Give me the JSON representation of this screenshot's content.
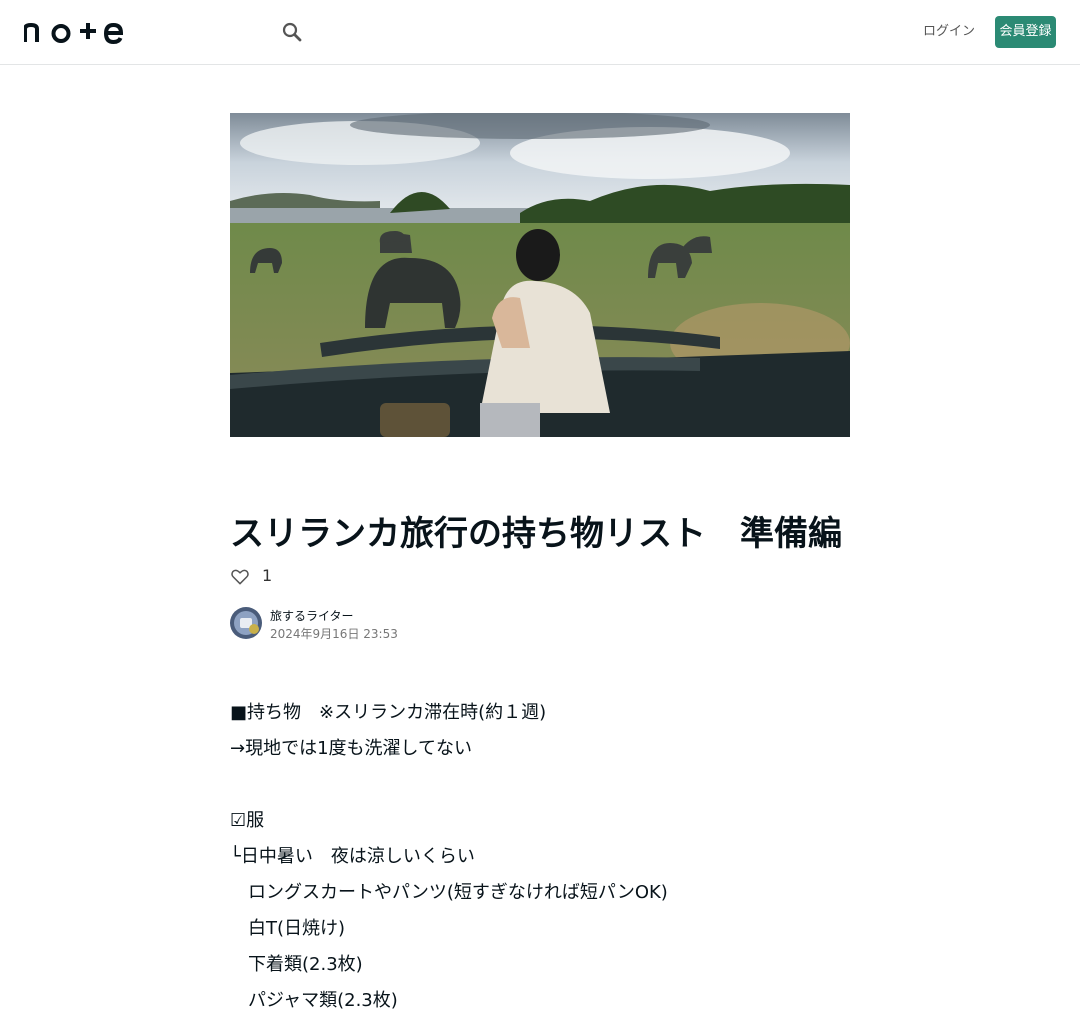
{
  "header": {
    "logo_text": "note",
    "search_icon": "search-icon",
    "login_label": "ログイン",
    "signup_label": "会員登録"
  },
  "article": {
    "hero_image_alt": "safari",
    "title": "スリランカ旅行の持ち物リスト　準備編",
    "like_icon": "heart-outline-icon",
    "like_count": "1",
    "author": {
      "name": "旅するライター",
      "date": "2024年9月16日 23:53"
    },
    "body_lines": [
      "■持ち物　※スリランカ滞在時(約１週)",
      "→現地では1度も洗濯してない",
      "",
      "☑服",
      "└日中暑い　夜は涼しいくらい",
      "　ロングスカートやパンツ(短すぎなければ短パンOK)",
      "　白T(日焼け)",
      "　下着類(2.3枚)",
      "　パジャマ類(2.3枚)"
    ]
  }
}
